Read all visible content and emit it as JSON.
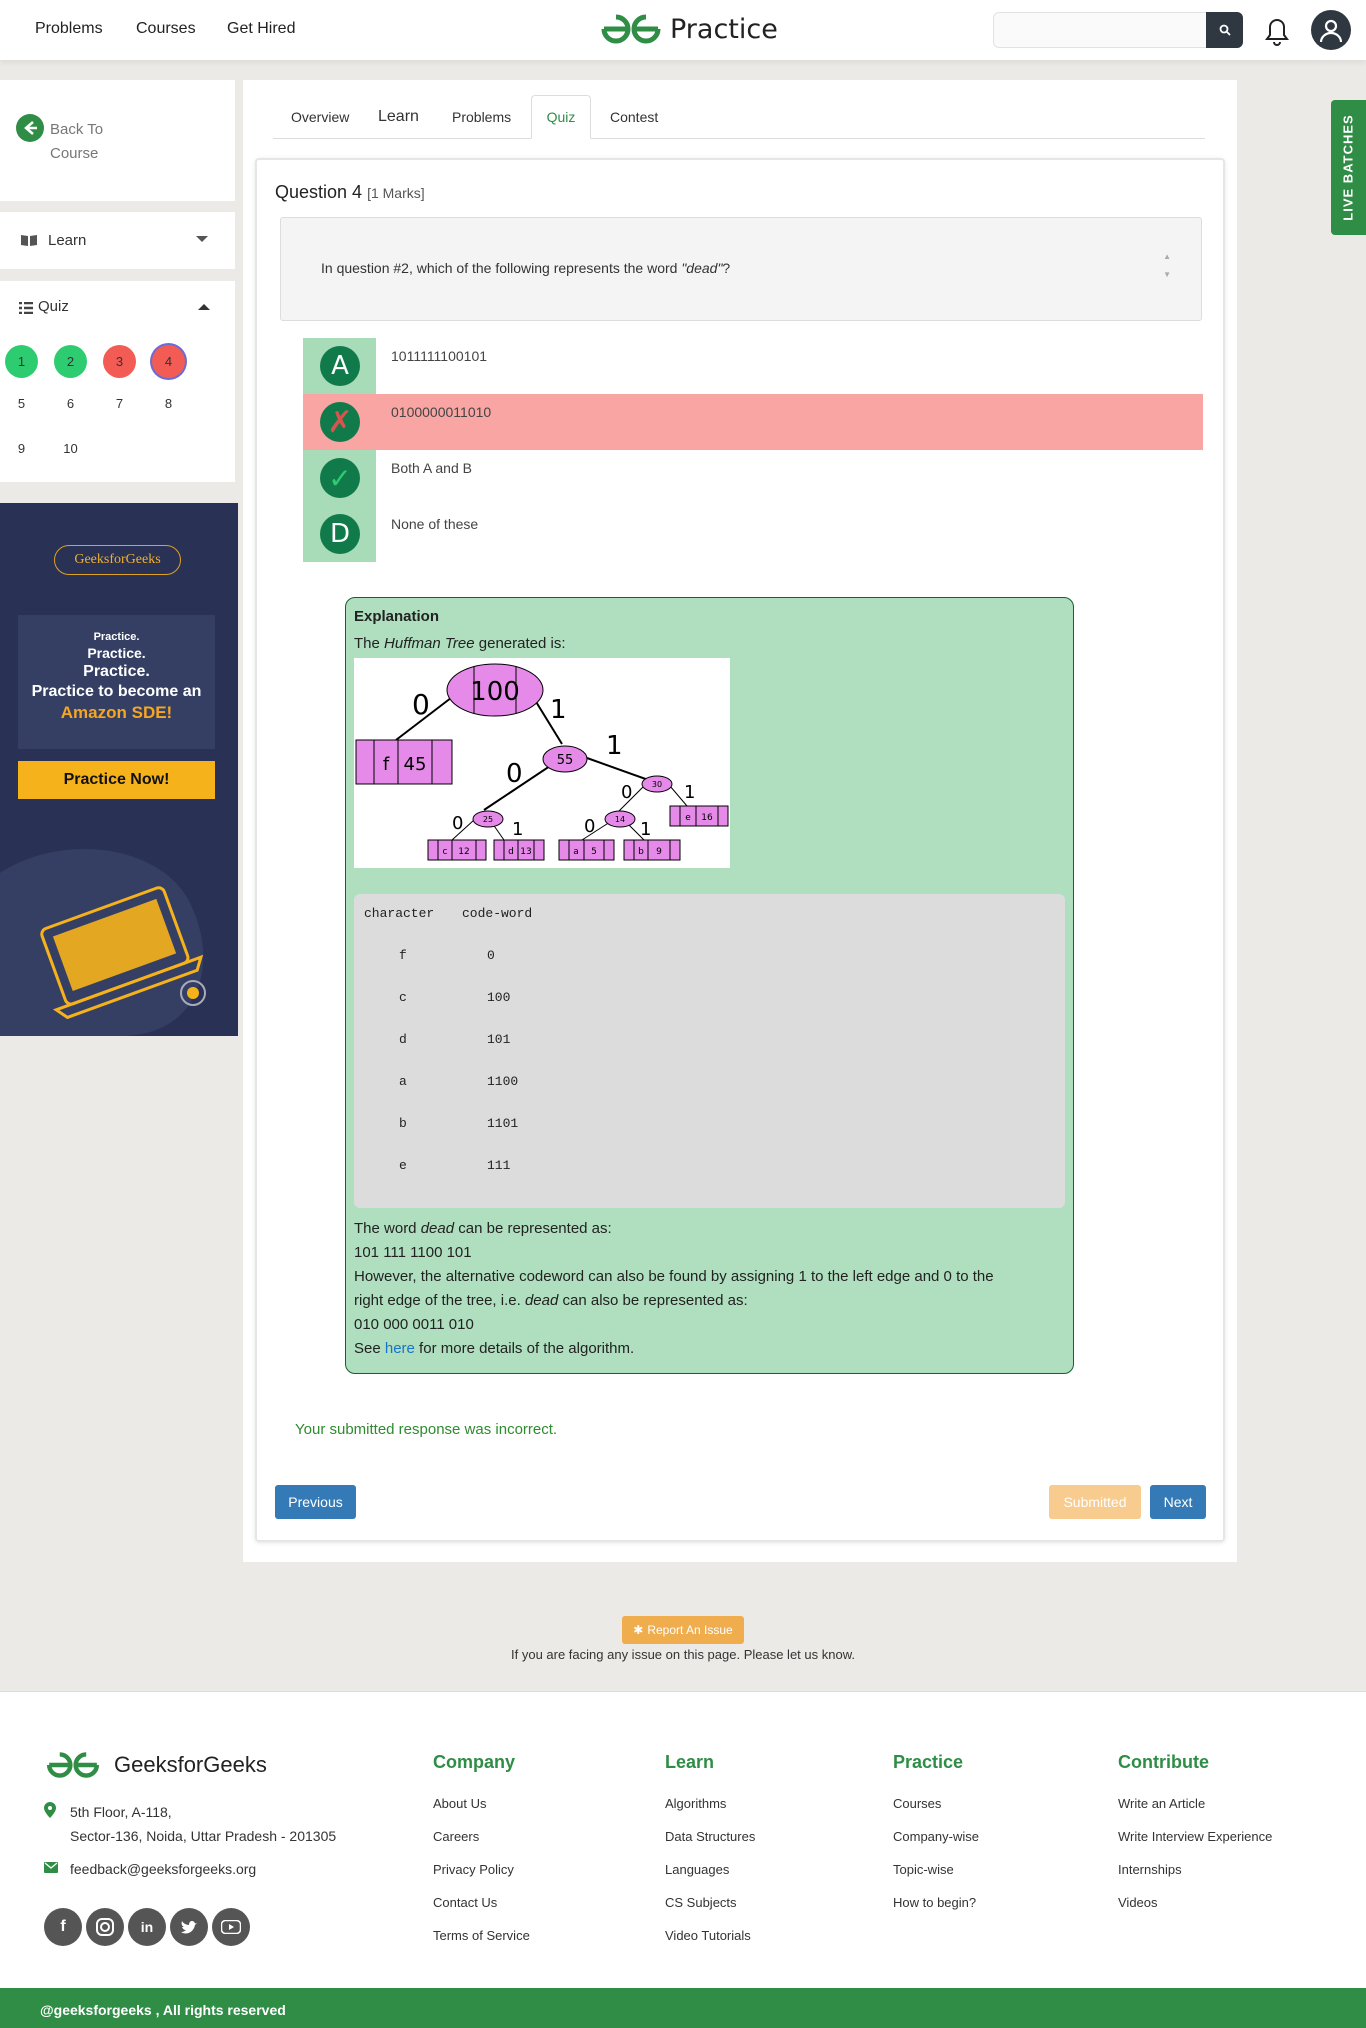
{
  "nav": {
    "links": [
      "Problems",
      "Courses",
      "Get Hired"
    ],
    "logo_text": "Practice",
    "search_placeholder": ""
  },
  "side": {
    "back_label": "Back To Course",
    "learn_label": "Learn",
    "quiz_label": "Quiz",
    "questions": [
      {
        "n": "1",
        "state": "correct"
      },
      {
        "n": "2",
        "state": "correct"
      },
      {
        "n": "3",
        "state": "incorrect"
      },
      {
        "n": "4",
        "state": "current"
      },
      {
        "n": "5",
        "state": "none"
      },
      {
        "n": "6",
        "state": "none"
      },
      {
        "n": "7",
        "state": "none"
      },
      {
        "n": "8",
        "state": "none"
      },
      {
        "n": "9",
        "state": "none"
      },
      {
        "n": "10",
        "state": "none"
      }
    ]
  },
  "ad": {
    "brand": "GeeksforGeeks",
    "line1": "Practice.",
    "line2": "Practice.",
    "line3": "Practice.",
    "line4": "Practice to become an",
    "line5": "Amazon SDE!",
    "cta": "Practice Now!"
  },
  "tabs": [
    {
      "label": "Overview",
      "active": false
    },
    {
      "label": "Learn",
      "active": false
    },
    {
      "label": "Problems",
      "active": false
    },
    {
      "label": "Quiz",
      "active": true
    },
    {
      "label": "Contest",
      "active": false
    }
  ],
  "question": {
    "title": "Question 4",
    "marks": "[1 Marks]",
    "text_pre": "In question #2, which of the following represents the word ",
    "text_em": "\"dead\"",
    "text_post": "?",
    "options": [
      {
        "letter": "A",
        "text": "1011111100101",
        "state": "plain"
      },
      {
        "letter": "✗",
        "text": "0100000011010",
        "state": "wrong"
      },
      {
        "letter": "✓",
        "text": "Both A and B",
        "state": "right"
      },
      {
        "letter": "D",
        "text": "None of these",
        "state": "plain"
      }
    ]
  },
  "explanation": {
    "heading": "Explanation",
    "intro_pre": "The ",
    "intro_em": "Huffman Tree",
    "intro_post": " generated is:",
    "tree": {
      "nodes": [
        "100",
        "55",
        "30",
        "25",
        "14"
      ],
      "edges": [
        "0",
        "1",
        "0",
        "1",
        "0",
        "1",
        "0",
        "1",
        "0",
        "1"
      ],
      "leaves": [
        {
          "ch": "f",
          "freq": "45"
        },
        {
          "ch": "e",
          "freq": "16"
        },
        {
          "ch": "c",
          "freq": "12"
        },
        {
          "ch": "d",
          "freq": "13"
        },
        {
          "ch": "a",
          "freq": "5"
        },
        {
          "ch": "b",
          "freq": "9"
        }
      ]
    },
    "table_header": [
      "character",
      "code-word"
    ],
    "table_rows": [
      [
        "f",
        "0"
      ],
      [
        "c",
        "100"
      ],
      [
        "d",
        "101"
      ],
      [
        "a",
        "1100"
      ],
      [
        "b",
        "1101"
      ],
      [
        "e",
        "111"
      ]
    ],
    "line1_pre": "The word ",
    "line1_em": "dead",
    "line1_post": " can be represented as:",
    "line2": "101 111 1100 101",
    "line3": "However, the alternative codeword can also be found by assigning 1 to the left edge and 0 to the",
    "line4_pre": "right edge of the tree, i.e. ",
    "line4_em": "dead",
    "line4_post": " can also be represented as:",
    "line5": "010 000 0011 010",
    "line6_pre": "See ",
    "line6_link": "here",
    "line6_post": " for more details of the algorithm."
  },
  "result_text": "Your submitted response was incorrect.",
  "buttons": {
    "previous": "Previous",
    "submitted": "Submitted",
    "next": "Next"
  },
  "live_batches": "LIVE BATCHES",
  "report": {
    "button": "Report An Issue",
    "text": "If you are facing any issue on this page. Please let us know."
  },
  "footer": {
    "brand": "GeeksforGeeks",
    "address1": "5th Floor, A-118,",
    "address2": "Sector-136, Noida, Uttar Pradesh - 201305",
    "email": "feedback@geeksforgeeks.org",
    "cols": [
      {
        "title": "Company",
        "links": [
          "About Us",
          "Careers",
          "Privacy Policy",
          "Contact Us",
          "Terms of Service"
        ]
      },
      {
        "title": "Learn",
        "links": [
          "Algorithms",
          "Data Structures",
          "Languages",
          "CS Subjects",
          "Video Tutorials"
        ]
      },
      {
        "title": "Practice",
        "links": [
          "Courses",
          "Company-wise",
          "Topic-wise",
          "How to begin?"
        ]
      },
      {
        "title": "Contribute",
        "links": [
          "Write an Article",
          "Write Interview Experience",
          "Internships",
          "Videos"
        ]
      }
    ],
    "social_icons": [
      "facebook-icon",
      "instagram-icon",
      "linkedin-icon",
      "twitter-icon",
      "youtube-icon"
    ],
    "copyright": "@geeksforgeeks , All rights reserved"
  },
  "colors": {
    "brand_green": "#2f8d46",
    "correct": "#2ecc71",
    "incorrect": "#f25c54",
    "wrong_row": "#f8a5a3",
    "option_badge": "#a8dbb8",
    "primary_btn": "#337ab7",
    "submitted_btn": "#f8cb8e",
    "explanation_bg": "#afdfbf"
  }
}
